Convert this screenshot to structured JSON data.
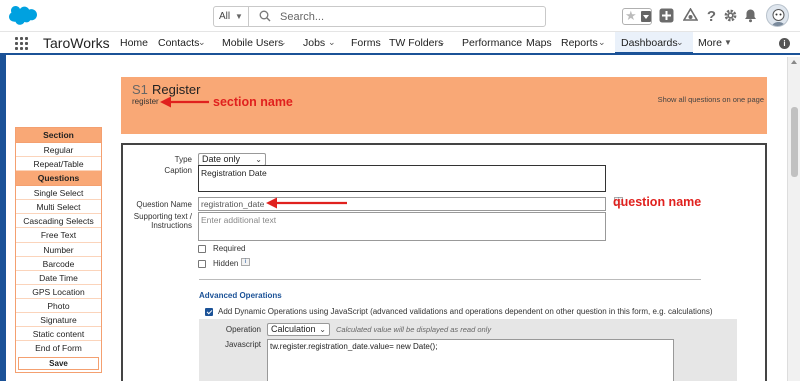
{
  "header": {
    "search_scope": "All",
    "search_placeholder": "Search...",
    "icons": [
      "salesforce-logo",
      "favorite-star-icon",
      "add-icon",
      "trailhead-icon",
      "help-icon",
      "settings-icon",
      "notifications-icon",
      "avatar"
    ]
  },
  "nav": {
    "app_name": "TaroWorks",
    "items": [
      {
        "label": "Home",
        "has_dropdown": false
      },
      {
        "label": "Contacts",
        "has_dropdown": true
      },
      {
        "label": "Mobile Users",
        "has_dropdown": true
      },
      {
        "label": "Jobs",
        "has_dropdown": true
      },
      {
        "label": "Forms",
        "has_dropdown": false
      },
      {
        "label": "TW Folders",
        "has_dropdown": true
      },
      {
        "label": "Performance",
        "has_dropdown": false
      },
      {
        "label": "Maps",
        "has_dropdown": false
      },
      {
        "label": "Reports",
        "has_dropdown": true
      },
      {
        "label": "Dashboards",
        "has_dropdown": true,
        "active": true
      },
      {
        "label": "More",
        "has_dropdown": true
      }
    ]
  },
  "palette": {
    "section_header": "Section",
    "section_items": [
      "Regular",
      "Repeat/Table"
    ],
    "questions_header": "Questions",
    "question_items": [
      "Single Select",
      "Multi Select",
      "Cascading Selects",
      "Free Text",
      "Number",
      "Barcode",
      "Date Time",
      "GPS Location",
      "Photo",
      "Signature",
      "Static content",
      "End of Form"
    ],
    "save_label": "Save"
  },
  "section": {
    "number": "S1",
    "title": "Register",
    "name": "register",
    "show_all_link": "Show all questions on one page"
  },
  "annotations": {
    "section_name": "section name",
    "question_name": "question name"
  },
  "question": {
    "type_label": "Type",
    "type_value": "Date only",
    "caption_label": "Caption",
    "caption_value": "Registration Date",
    "question_name_label": "Question Name",
    "question_name_value": "registration_date",
    "supporting_label_1": "Supporting text /",
    "supporting_label_2": "Instructions",
    "supporting_placeholder": "Enter additional text",
    "required_label": "Required",
    "required_checked": false,
    "hidden_label": "Hidden",
    "hidden_checked": false
  },
  "advanced": {
    "title": "Advanced Operations",
    "dynamic_ops_label": "Add Dynamic Operations using JavaScript (advanced validations and operations dependent on other question in this form, e.g. calculations)",
    "dynamic_ops_checked": true,
    "operation_label": "Operation",
    "operation_value": "Calculation",
    "operation_hint": "Calculated value will be displayed as read only",
    "javascript_label": "Javascript",
    "javascript_value": "tw.register.registration_date.value= new Date();"
  },
  "colors": {
    "accent_blue": "#1b5297",
    "section_orange": "#f9a876",
    "annotation_red": "#e0211e"
  }
}
